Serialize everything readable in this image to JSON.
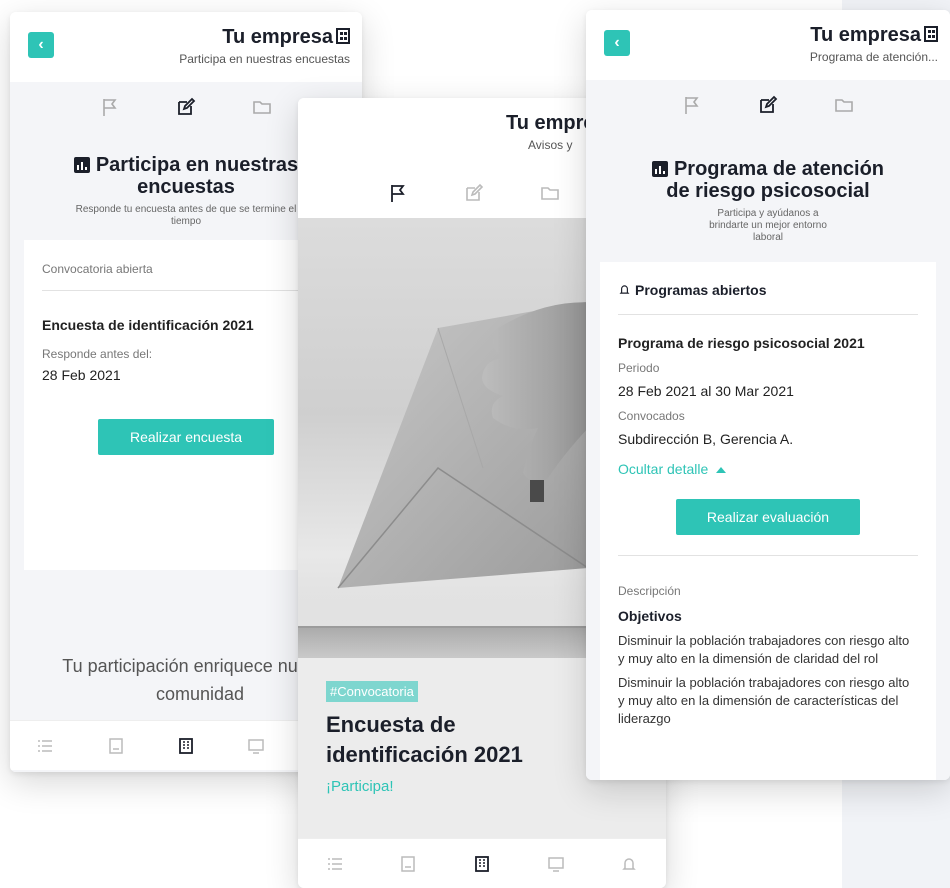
{
  "colors": {
    "accent": "#2ec4b6",
    "dark": "#1b1f2a"
  },
  "left": {
    "header": {
      "title": "Tu empresa",
      "subtitle": "Participa en nuestras encuestas"
    },
    "section": {
      "title": "Participa en nuestras encuestas",
      "desc": "Responde tu encuesta antes de que se termine el tiempo"
    },
    "card": {
      "heading": "Convocatoria abierta",
      "survey_title": "Encuesta de identificación 2021",
      "deadline_label": "Responde antes del:",
      "deadline_value": "28 Feb 2021",
      "button": "Realizar encuesta"
    },
    "footer_text": "Tu participación enriquece nuestra comunidad"
  },
  "middle": {
    "header": {
      "title": "Tu empresa",
      "subtitle": "Avisos y"
    },
    "tag": "#Convocatoria",
    "title": "Encuesta de identificación 2021",
    "cta": "¡Participa!"
  },
  "right": {
    "header": {
      "title": "Tu empresa",
      "subtitle": "Programa de atención..."
    },
    "section": {
      "title": "Programa de atención de riesgo psicosocial",
      "desc": "Participa y ayúdanos a brindarte un mejor entorno laboral"
    },
    "programs": {
      "heading": "Programas abiertos",
      "program_title": "Programa de riesgo psicosocial 2021",
      "period_label": "Periodo",
      "period_value": "28 Feb 2021 al 30 Mar 2021",
      "convocados_label": "Convocados",
      "convocados_value": "Subdirección B, Gerencia A.",
      "toggle": "Ocultar detalle",
      "button": "Realizar evaluación"
    },
    "description": {
      "label": "Descripción",
      "heading": "Objetivos",
      "items": [
        "Disminuir la población trabajadores con riesgo alto y muy alto en la dimensión de claridad del rol",
        "Disminuir la población trabajadores con riesgo alto y muy alto en la dimensión de características del liderazgo"
      ]
    }
  }
}
